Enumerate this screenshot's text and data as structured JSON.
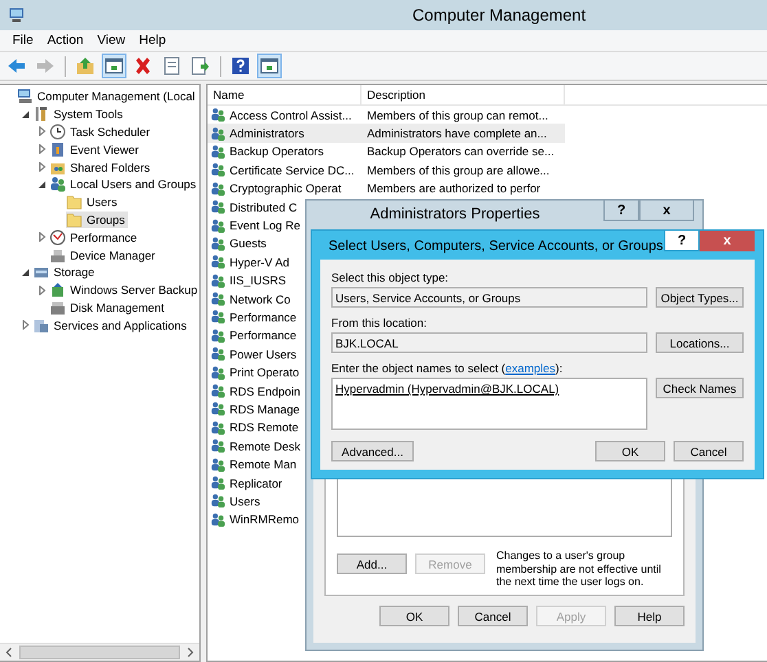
{
  "window": {
    "title": "Computer Management"
  },
  "menu": [
    {
      "label": "File"
    },
    {
      "label": "Action"
    },
    {
      "label": "View"
    },
    {
      "label": "Help"
    }
  ],
  "toolbar": [
    [
      {
        "kind": "back",
        "disabled": false,
        "pressed": false
      },
      {
        "kind": "forward",
        "disabled": true,
        "pressed": false
      }
    ],
    [
      {
        "kind": "up",
        "disabled": false,
        "pressed": false
      },
      {
        "kind": "tree",
        "disabled": false,
        "pressed": true
      },
      {
        "kind": "delete",
        "disabled": false,
        "pressed": false
      },
      {
        "kind": "properties",
        "disabled": false,
        "pressed": false
      },
      {
        "kind": "export",
        "disabled": false,
        "pressed": false
      }
    ],
    [
      {
        "kind": "help",
        "disabled": false,
        "pressed": false
      },
      {
        "kind": "pane",
        "disabled": false,
        "pressed": true
      }
    ]
  ],
  "tree": [
    {
      "label": "Computer Management (Local",
      "kind": "computer",
      "selected": false,
      "children": [
        {
          "label": "System Tools",
          "kind": "tools",
          "selected": false,
          "expanded": true,
          "children": [
            {
              "label": "Task Scheduler",
              "kind": "clock",
              "selected": false,
              "expanded": false
            },
            {
              "label": "Event Viewer",
              "kind": "viewer",
              "selected": false,
              "expanded": false
            },
            {
              "label": "Shared Folders",
              "kind": "share",
              "selected": false,
              "expanded": false
            },
            {
              "label": "Local Users and Groups",
              "kind": "users",
              "selected": false,
              "expanded": true,
              "children": [
                {
                  "label": "Users",
                  "kind": "folder",
                  "selected": false
                },
                {
                  "label": "Groups",
                  "kind": "folder",
                  "selected": true
                }
              ]
            },
            {
              "label": "Performance",
              "kind": "performance",
              "selected": false,
              "expanded": false
            },
            {
              "label": "Device Manager",
              "kind": "device",
              "selected": false
            }
          ]
        },
        {
          "label": "Storage",
          "kind": "storage",
          "selected": false,
          "expanded": true,
          "children": [
            {
              "label": "Windows Server Backup",
              "kind": "backup",
              "selected": false,
              "expanded": false
            },
            {
              "label": "Disk Management",
              "kind": "disk",
              "selected": false
            }
          ]
        },
        {
          "label": "Services and Applications",
          "kind": "services",
          "selected": false,
          "expanded": false
        }
      ]
    }
  ],
  "list": {
    "columns": [
      "Name",
      "Description"
    ],
    "rows": [
      {
        "name": "Access Control Assist...",
        "description": "Members of this group can remot...",
        "selected": false
      },
      {
        "name": "Administrators",
        "description": "Administrators have complete an...",
        "selected": true
      },
      {
        "name": "Backup Operators",
        "description": "Backup Operators can override se...",
        "selected": false
      },
      {
        "name": "Certificate Service DC...",
        "description": "Members of this group are allowe...",
        "selected": false
      },
      {
        "name": "Cryptographic Operat",
        "description": "Members are authorized to perfor",
        "selected": false
      },
      {
        "name": "Distributed C",
        "selected": false
      },
      {
        "name": "Event Log Re",
        "selected": false
      },
      {
        "name": "Guests",
        "selected": false
      },
      {
        "name": "Hyper-V Ad",
        "selected": false
      },
      {
        "name": "IIS_IUSRS",
        "selected": false
      },
      {
        "name": "Network Co",
        "selected": false
      },
      {
        "name": "Performance",
        "selected": false
      },
      {
        "name": "Performance",
        "selected": false
      },
      {
        "name": "Power Users",
        "selected": false
      },
      {
        "name": "Print Operato",
        "selected": false
      },
      {
        "name": "RDS Endpoin",
        "selected": false
      },
      {
        "name": "RDS Manage",
        "selected": false
      },
      {
        "name": "RDS Remote",
        "selected": false
      },
      {
        "name": "Remote Desk",
        "selected": false
      },
      {
        "name": "Remote Man",
        "selected": false
      },
      {
        "name": "Replicator",
        "selected": false
      },
      {
        "name": "Users",
        "selected": false
      },
      {
        "name": "WinRMRemo",
        "selected": false
      }
    ]
  },
  "properties_dialog": {
    "title": "Administrators Properties",
    "help_button": "?",
    "close_button": "x",
    "member_buttons": [
      {
        "label": "Add...",
        "disabled": false
      },
      {
        "label": "Remove",
        "disabled": true
      }
    ],
    "note": "Changes to a user's group membership are not effective until the next time the user logs on.",
    "buttons": [
      {
        "label": "OK",
        "disabled": false
      },
      {
        "label": "Cancel",
        "disabled": false
      },
      {
        "label": "Apply",
        "disabled": true
      },
      {
        "label": "Help",
        "disabled": false
      }
    ]
  },
  "select_dialog": {
    "title": "Select Users, Computers, Service Accounts, or Groups",
    "help_button": "?",
    "close_button": "x",
    "object_type_label": "Select this object type:",
    "object_type": "Users, Service Accounts, or Groups",
    "object_types_button": "Object Types...",
    "location_label": "From this location:",
    "location": "BJK.LOCAL",
    "locations_button": "Locations...",
    "names_label_before": "Enter the object names to select (",
    "names_label_link": "examples",
    "names_label_after": "):",
    "names": "Hypervadmin (Hypervadmin@BJK.LOCAL)",
    "check_names_button": "Check Names",
    "advanced_button": "Advanced...",
    "ok_button": "OK",
    "cancel_button": "Cancel"
  }
}
